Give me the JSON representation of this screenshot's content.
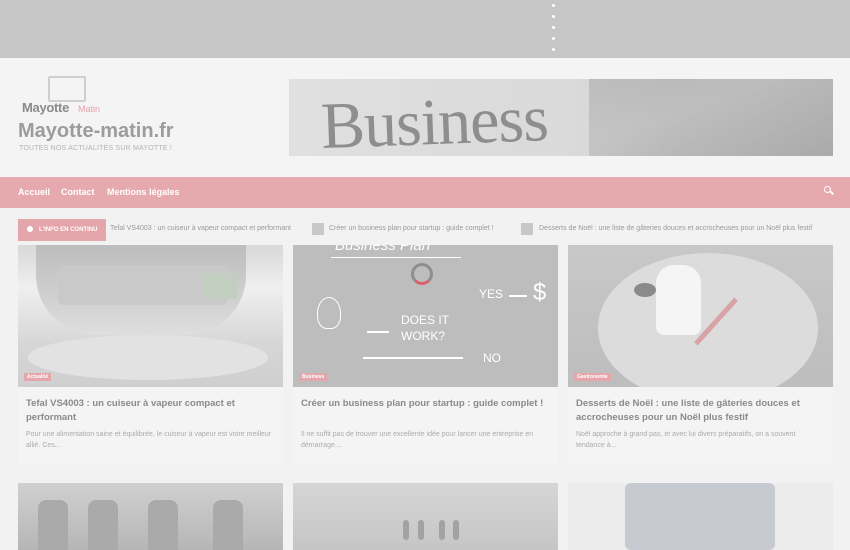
{
  "site": {
    "logo_brand": "Mayotte",
    "logo_brand_suffix": "Matin",
    "title": "Mayotte-matin.fr",
    "tagline": "TOUTES NOS ACTUALITÉS SUR MAYOTTE !",
    "banner_word": "Business"
  },
  "nav": {
    "items": [
      "Accueil",
      "Contact",
      "Mentions légales"
    ]
  },
  "ticker": {
    "badge": "L'INFO EN CONTINU",
    "items": [
      "Tefal VS4003 : un cuiseur à vapeur compact et performant",
      "Créer un business plan pour startup : guide complet !",
      "Desserts de Noël : une liste de gâteries douces et accrocheuses pour un Noël plus festif"
    ]
  },
  "posts": [
    {
      "category": "Actualité",
      "title": "Tefal VS4003 : un cuiseur à vapeur compact et performant",
      "excerpt": "Pour une alimentation saine et équilibrée, le cuiseur à vapeur est votre meilleur allié. Ces..."
    },
    {
      "category": "Business",
      "title": "Créer un business plan pour startup : guide complet !",
      "excerpt": "Il ne suffit pas de trouver une excellente idée pour lancer une entreprise en démarrage...."
    },
    {
      "category": "Gastronomie",
      "title": "Desserts de Noël : une liste de gâteries douces et accrocheuses pour un Noël plus festif",
      "excerpt": "Noël approche à grand pas, et avec lui divers préparatifs, on a souvent tendance à..."
    }
  ],
  "img2_text": {
    "plan": "Business Plan",
    "does": "DOES IT",
    "work": "WORK?",
    "yes": "YES",
    "dollar": "$",
    "no": "NO"
  },
  "colors": {
    "accent": "#e6a9ad",
    "topbar": "#c6c6c6",
    "background": "#f2f2f2"
  },
  "icons": {
    "search": "search-icon",
    "live_dot": "live-dot-icon"
  }
}
